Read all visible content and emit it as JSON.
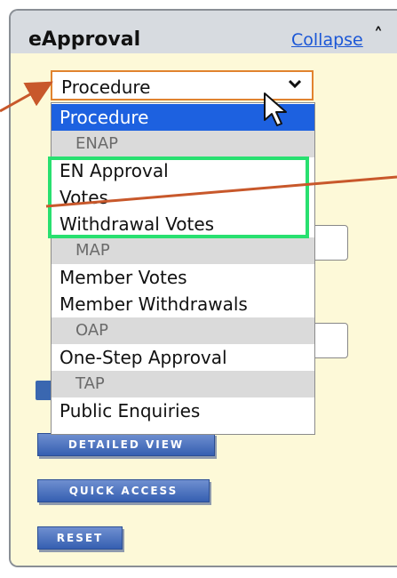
{
  "panel": {
    "title": "eApproval",
    "collapse_label": "Collapse",
    "collapse_icon": "double-chevron-up"
  },
  "select": {
    "value": "Procedure",
    "icon": "chevron-down-icon",
    "border_color": "#e1832f"
  },
  "dropdown": {
    "items": [
      {
        "type": "option",
        "label": "Procedure",
        "selected": true
      },
      {
        "type": "group",
        "label": "ENAP"
      },
      {
        "type": "option",
        "label": "EN Approval"
      },
      {
        "type": "option",
        "label": "Votes"
      },
      {
        "type": "option",
        "label": "Withdrawal Votes"
      },
      {
        "type": "group",
        "label": "MAP"
      },
      {
        "type": "option",
        "label": "Member Votes"
      },
      {
        "type": "option",
        "label": "Member Withdrawals"
      },
      {
        "type": "group",
        "label": "OAP"
      },
      {
        "type": "option",
        "label": "One-Step Approval"
      },
      {
        "type": "group",
        "label": "TAP"
      },
      {
        "type": "option",
        "label": "Public Enquiries"
      }
    ],
    "selected_color": "#1d61e0",
    "highlight_color": "#28e070"
  },
  "buttons": {
    "detailed_view": "DETAILED VIEW",
    "quick_access": "QUICK ACCESS",
    "reset": "RESET"
  },
  "annotations": {
    "arrow_color": "#c8582b"
  }
}
